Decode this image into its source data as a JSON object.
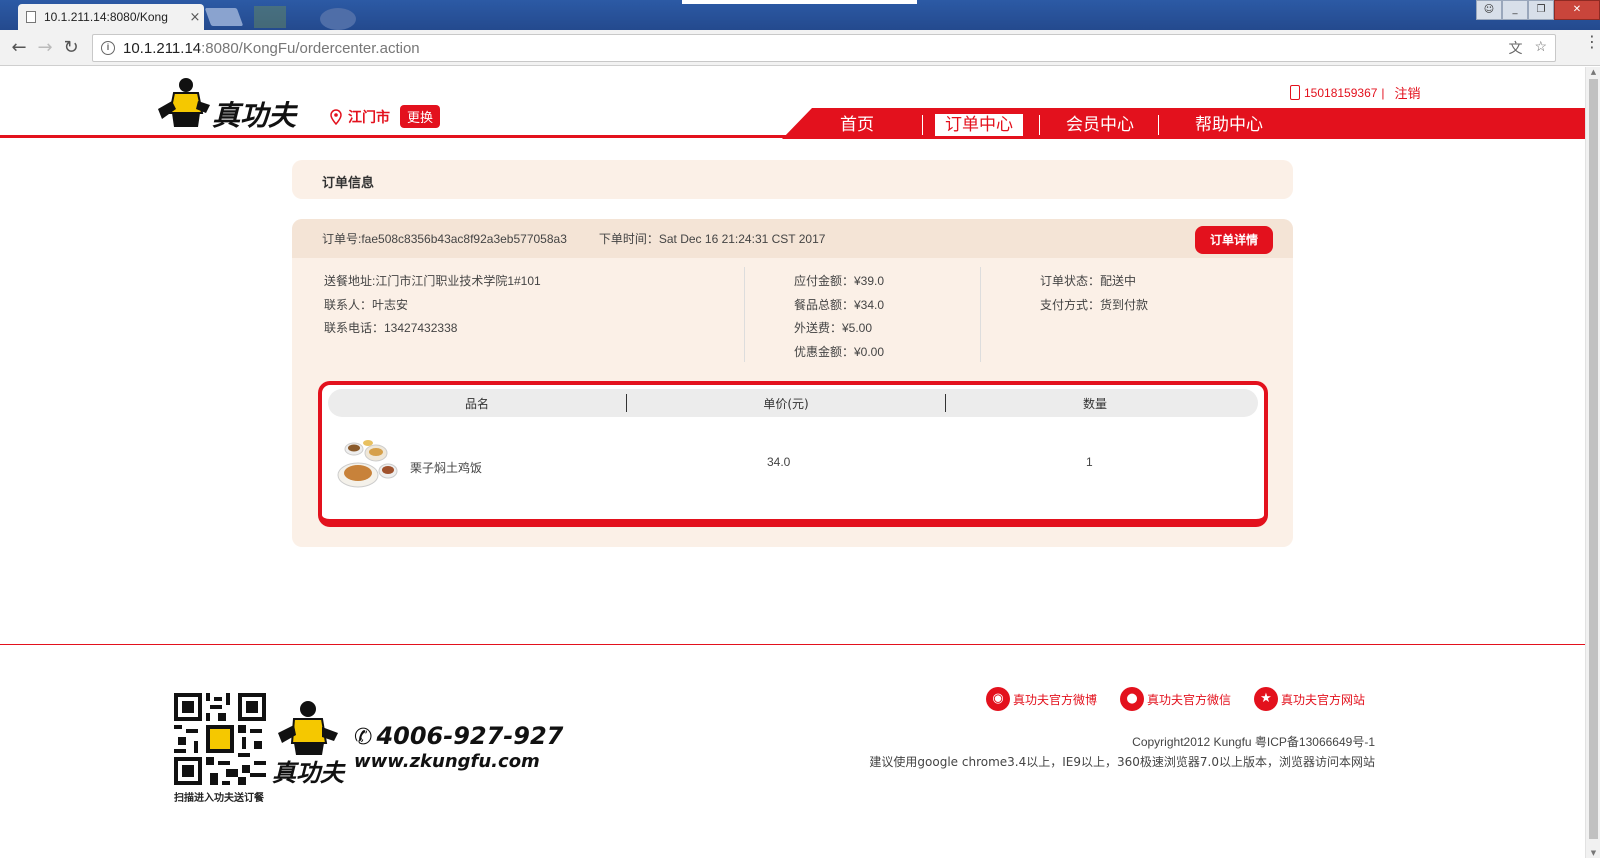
{
  "browser": {
    "tab_title": "10.1.211.14:8080/Kong",
    "tab_close": "×",
    "url_host": "10.1.211.14",
    "url_path": ":8080/KongFu/ordercenter.action",
    "back": "←",
    "forward": "→",
    "reload": "↻",
    "info": "i",
    "translate_icon": "文",
    "star_icon": "☆",
    "menu": "⋮"
  },
  "header": {
    "logo_text": "真功夫",
    "city": "江门市",
    "city_change": "更换",
    "phone": "15018159367",
    "separator": "|",
    "logout": "注销",
    "nav": [
      "首页",
      "订单中心",
      "会员中心",
      "帮助中心"
    ],
    "active_nav_index": 1
  },
  "order_info_title": "订单信息",
  "order": {
    "number": "订单号:fae508c8356b43ac8f92a3eb577058a3",
    "time": "下单时间：Sat Dec 16 21:24:31 CST 2017",
    "detail_button": "订单详情",
    "address": "送餐地址:江门市江门职业技术学院1#101",
    "contact": "联系人：叶志安",
    "contact_phone": "联系电话：13427432338",
    "payable": "应付金额：¥39.0",
    "items_total": "餐品总额：¥34.0",
    "delivery_fee": "外送费：¥5.00",
    "discount": "优惠金额：¥0.00",
    "status": "订单状态：配送中",
    "payment": "支付方式：货到付款",
    "columns": [
      "品名",
      "单价(元)",
      "数量"
    ],
    "items": [
      {
        "name": "栗子焖土鸡饭",
        "price": "34.0",
        "qty": "1"
      }
    ]
  },
  "footer": {
    "qr_caption": "扫描进入功夫送订餐",
    "hotline": "4006-927-927",
    "url": "www.zkungfu.com",
    "social": [
      "真功夫官方微博",
      "真功夫官方微信",
      "真功夫官方网站"
    ],
    "copyright": "Copyright2012 Kungfu 粤ICP备13066649号-1",
    "advice": "建议使用google chrome3.4以上，IE9以上，360极速浏览器7.0以上版本，浏览器访问本网站"
  },
  "colors": {
    "brand_red": "#e3111d",
    "panel_bg": "#fbf0e7",
    "panel_head": "#f4e4d6"
  }
}
